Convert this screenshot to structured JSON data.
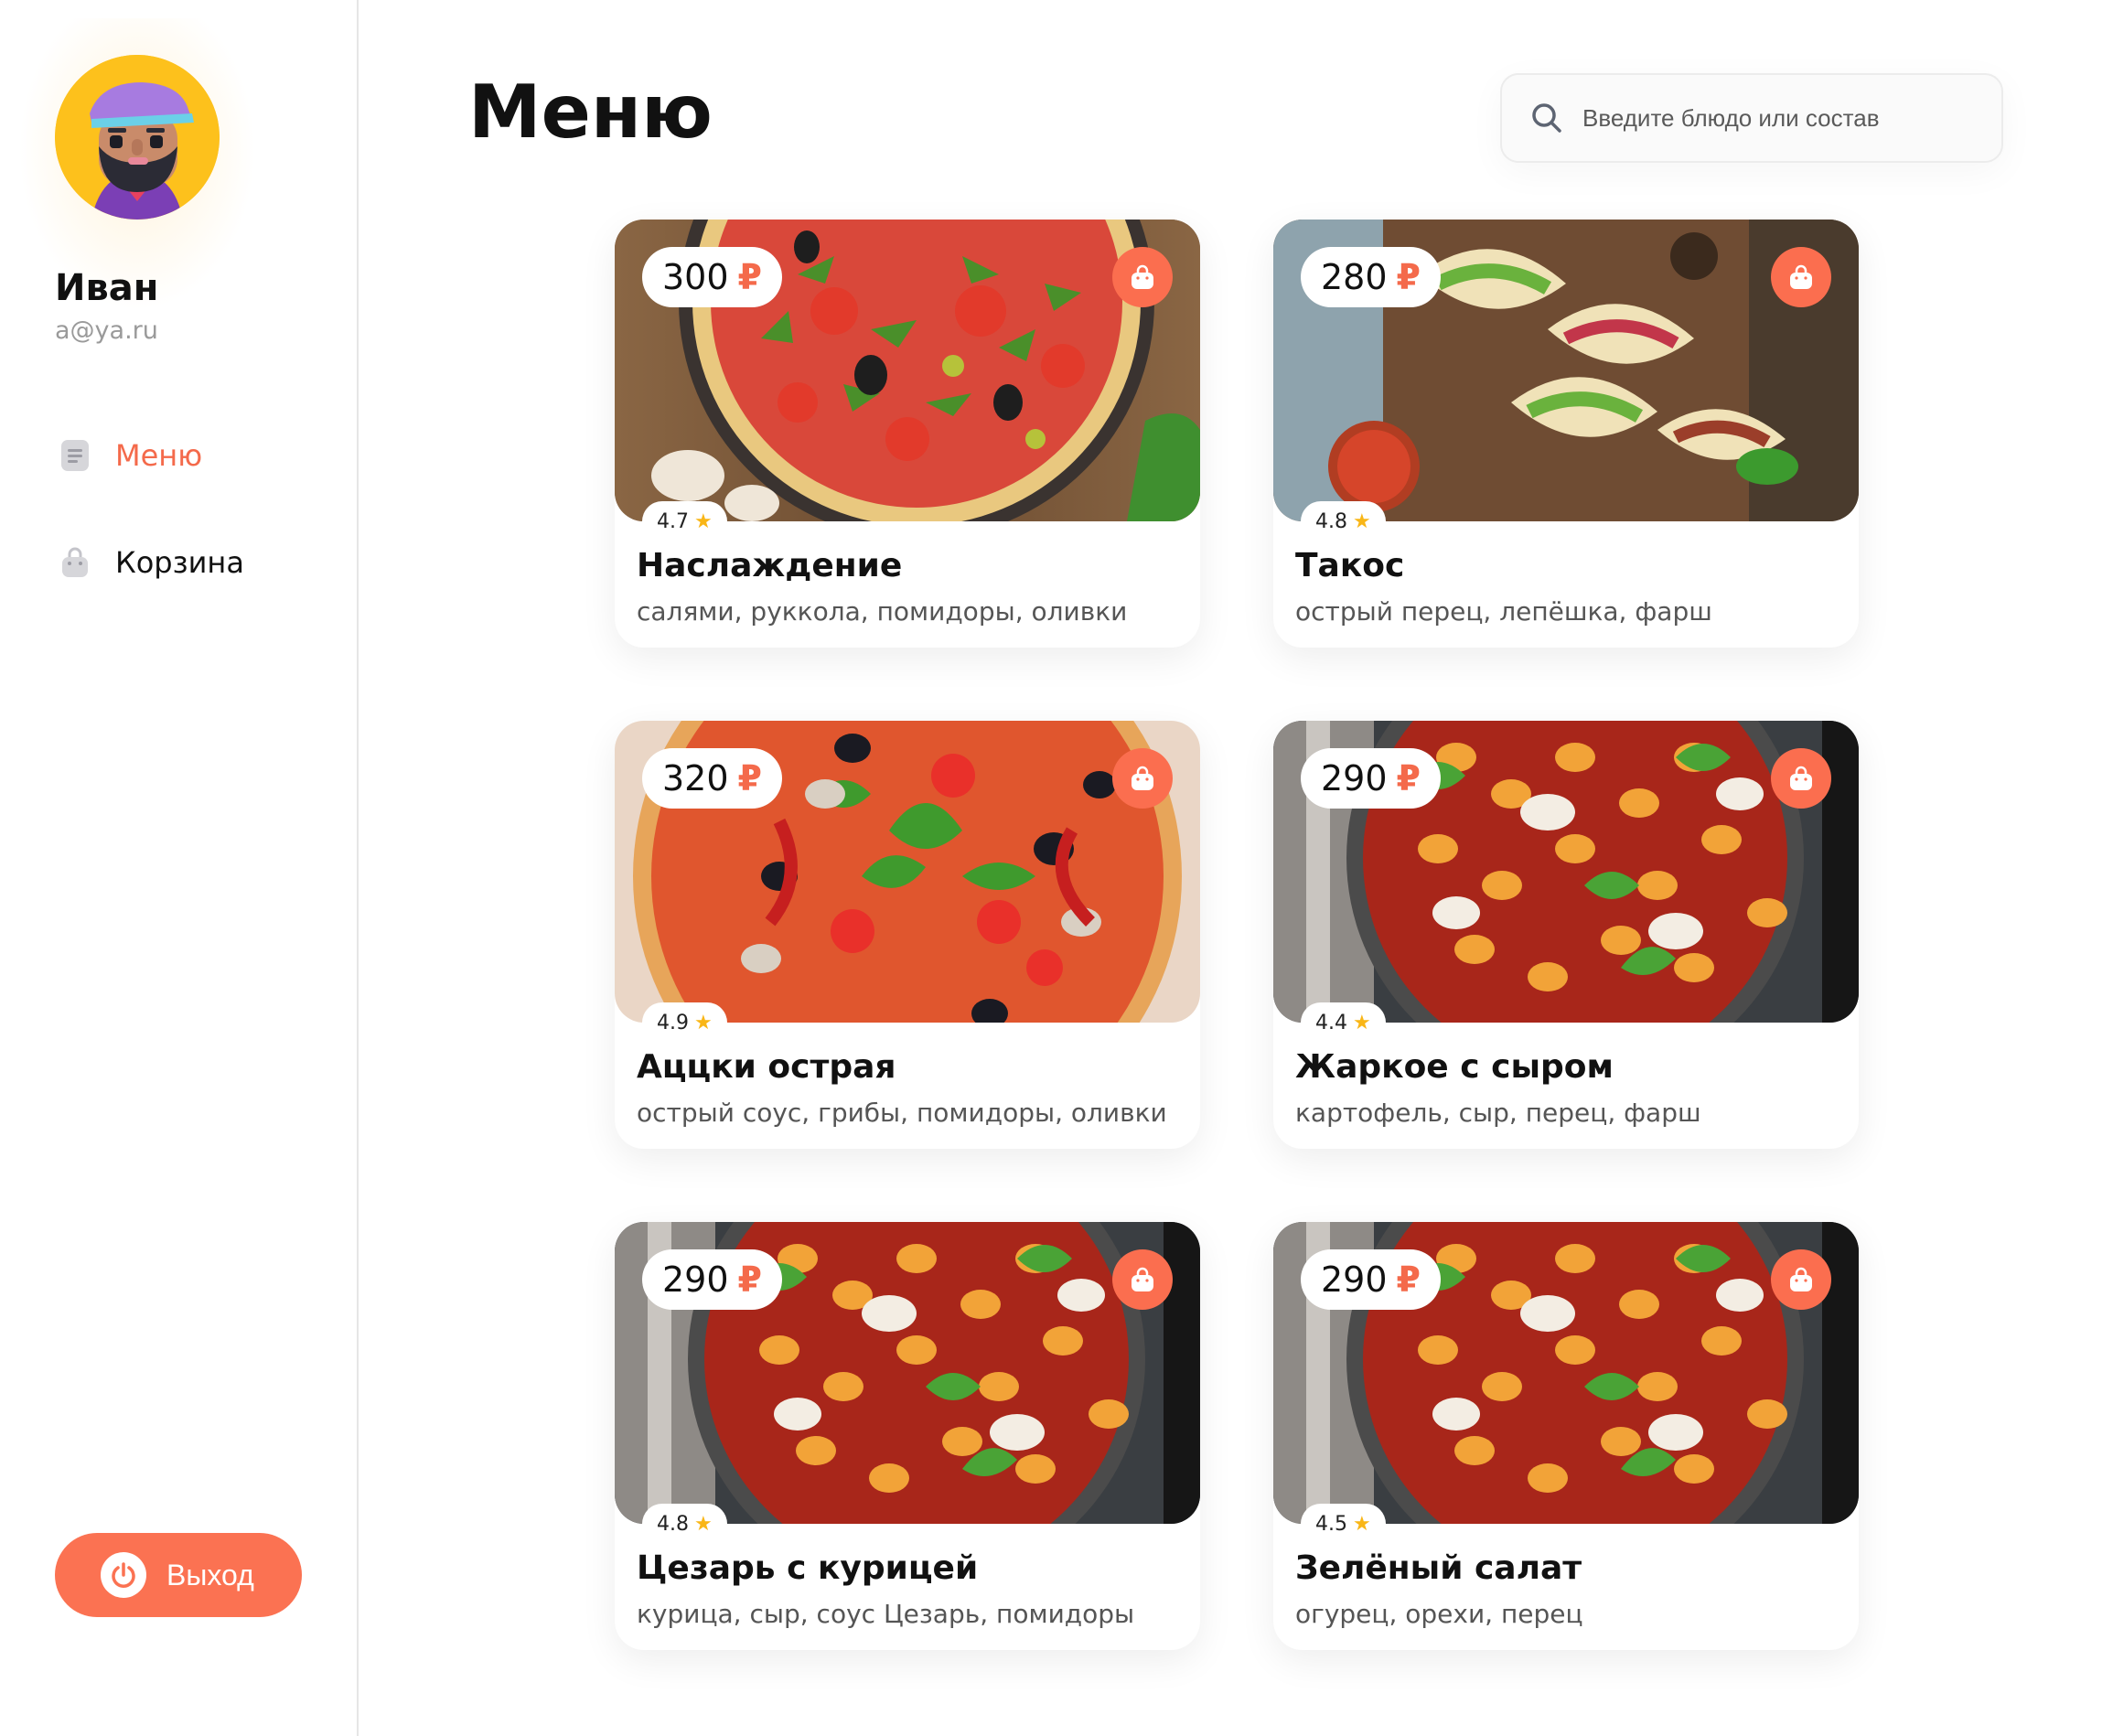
{
  "user": {
    "name": "Иван",
    "email": "a@ya.ru"
  },
  "nav": {
    "items": [
      {
        "label": "Меню",
        "icon": "menu-document-icon",
        "active": true
      },
      {
        "label": "Корзина",
        "icon": "shopping-bag-icon",
        "active": false
      }
    ],
    "logout_label": "Выход"
  },
  "page": {
    "title": "Меню"
  },
  "search": {
    "placeholder": "Введите блюдо или состав",
    "value": ""
  },
  "currency": "₽",
  "colors": {
    "accent": "#fb6e4f",
    "star": "#f9b617",
    "avatar_bg": "#fdc11c"
  },
  "products": [
    {
      "price": "300",
      "rating": "4.7",
      "title": "Наслаждение",
      "description": "салями, руккола, помидоры, оливки",
      "image": "pizza-arugula"
    },
    {
      "price": "280",
      "rating": "4.8",
      "title": "Такос",
      "description": "острый перец, лепёшка, фарш",
      "image": "tacos"
    },
    {
      "price": "320",
      "rating": "4.9",
      "title": "Аццки острая",
      "description": "острый соус, грибы, помидоры, оливки",
      "image": "pizza-spicy"
    },
    {
      "price": "290",
      "rating": "4.4",
      "title": "Жаркое с сыром",
      "description": "картофель, сыр, перец, фарш",
      "image": "gnocchi-pan"
    },
    {
      "price": "290",
      "rating": "4.8",
      "title": "Цезарь с курицей",
      "description": "курица, сыр, соус Цезарь, помидоры",
      "image": "gnocchi-pan"
    },
    {
      "price": "290",
      "rating": "4.5",
      "title": "Зелёный салат",
      "description": "огурец, орехи, перец",
      "image": "gnocchi-pan"
    }
  ]
}
